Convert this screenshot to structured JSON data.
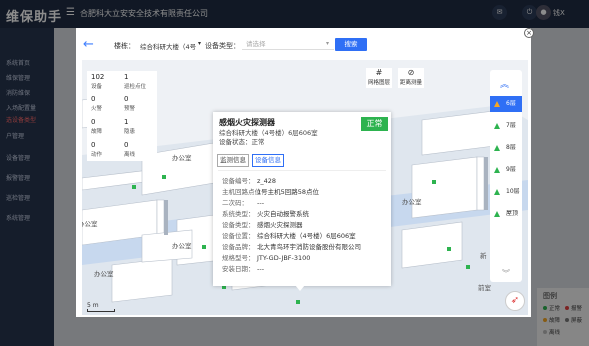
{
  "app": {
    "title": "维保助手",
    "org": "合肥科大立安安全技术有限责任公司",
    "user": "钱X",
    "sidebar": [
      "系统首页",
      "维保管理",
      "消防维保",
      "入场配置量",
      "选设备类型",
      "户管理",
      "设备管理",
      "报警管理",
      "巡检管理",
      "系统管理"
    ]
  },
  "legend": {
    "title": "图例",
    "items": [
      {
        "label": "正常",
        "color": "#2db34f"
      },
      {
        "label": "报警",
        "color": "#e04040"
      },
      {
        "label": "故障",
        "color": "#f5a623"
      },
      {
        "label": "屏蔽",
        "color": "#7a7a7a"
      },
      {
        "label": "离线",
        "color": "#bbbbbb"
      }
    ]
  },
  "modal": {
    "building_label": "楼栋：",
    "building_value": "综合科研大楼（4号",
    "device_type_label": "设备类型：",
    "device_type_placeholder": "请选择",
    "search_button": "搜索",
    "close": "×",
    "back": "←"
  },
  "stats": [
    {
      "value": "102",
      "label": "设备"
    },
    {
      "value": "1",
      "label": "巡检点位"
    },
    {
      "value": "0",
      "label": "火警"
    },
    {
      "value": "0",
      "label": "预警"
    },
    {
      "value": "0",
      "label": "故障"
    },
    {
      "value": "1",
      "label": "隐患"
    },
    {
      "value": "0",
      "label": "动作"
    },
    {
      "value": "0",
      "label": "离线"
    }
  ],
  "tools": [
    {
      "label": "网格图层",
      "icon": "grid-icon"
    },
    {
      "label": "距离测量",
      "icon": "ruler-icon"
    }
  ],
  "floors": {
    "items": [
      "6层",
      "7层",
      "8层",
      "9层",
      "10层",
      "屋顶"
    ],
    "active_index": 0
  },
  "map": {
    "room_labels": [
      "办公室",
      "办公室",
      "办公室",
      "办公室",
      "办公室",
      "前室",
      "新"
    ],
    "scale": "5 m"
  },
  "popup": {
    "title": "感烟火灾探测器",
    "location": "综合科研大楼（4号楼）6层606室",
    "status_line": "设备状态：正常",
    "badge": "正常",
    "badge_color": "#2db34f",
    "tabs": [
      "监测信息",
      "设备信息"
    ],
    "active_tab": 1,
    "fields": [
      {
        "key": "设备编号：",
        "value": "z_428"
      },
      {
        "key": "主机回路点位：",
        "value": "1号主机5回路58点位"
      },
      {
        "key": "二次码：",
        "value": "---"
      },
      {
        "key": "系统类型：",
        "value": "火灾自动报警系统"
      },
      {
        "key": "设备类型：",
        "value": "感烟火灾探测器"
      },
      {
        "key": "设备位置：",
        "value": "综合科研大楼（4号楼）6层606室"
      },
      {
        "key": "设备品牌：",
        "value": "北大青鸟环宇消防设备股份有限公司"
      },
      {
        "key": "规格型号：",
        "value": "JTY-GD-JBF-3100"
      },
      {
        "key": "安装日期：",
        "value": "---"
      }
    ]
  }
}
